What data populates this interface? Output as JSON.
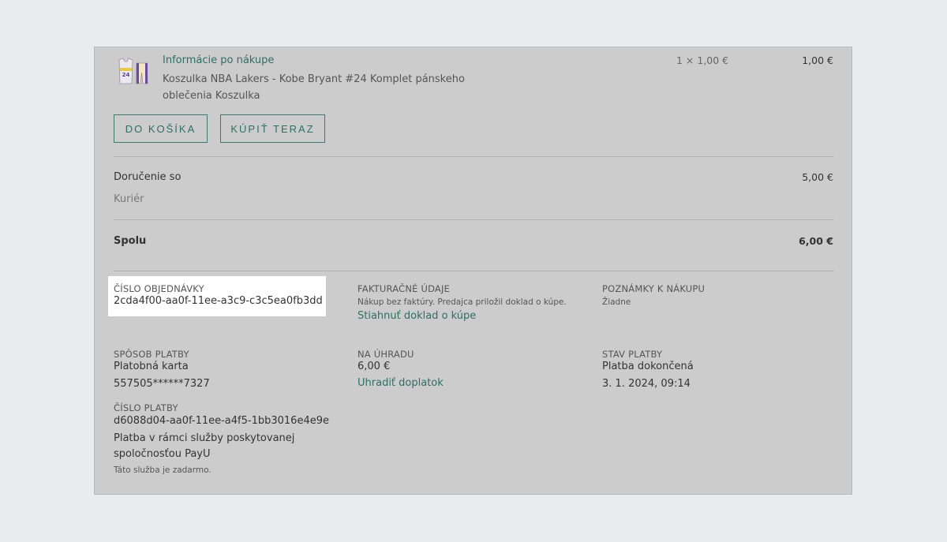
{
  "product": {
    "title": "Informácie po nákupe",
    "description": "Koszulka NBA Lakers - Kobe Bryant #24 Komplet pánskeho oblečenia Koszulka",
    "qty_price": "1 × 1,00 €",
    "line_price": "1,00 €",
    "image_icon": "jersey-icon",
    "jersey_number": "24"
  },
  "buttons": {
    "add_to_cart": "DO KOŠÍKA",
    "buy_now": "KÚPIŤ TERAZ"
  },
  "delivery": {
    "label": "Doručenie so",
    "method": "Kuriér",
    "price": "5,00 €"
  },
  "total": {
    "label": "Spolu",
    "price": "6,00 €"
  },
  "order": {
    "number_label": "ČÍSLO OBJEDNÁVKY",
    "number_value": "2cda4f00-aa0f-11ee-a3c9-c3c5ea0fb3dd"
  },
  "billing": {
    "label": "FAKTURAČNÉ ÚDAJE",
    "note": "Nákup bez faktúry. Predajca priložil doklad o kúpe.",
    "download_link": "Stiahnuť doklad o kúpe"
  },
  "notes": {
    "label": "POZNÁMKY K NÁKUPU",
    "value": "Žiadne"
  },
  "payment_method": {
    "label": "SPÔSOB PLATBY",
    "value": "Platobná karta",
    "card": "557505******7327"
  },
  "due": {
    "label": "NA ÚHRADU",
    "value": "6,00 €",
    "pay_link": "Uhradiť doplatok"
  },
  "payment_status": {
    "label": "STAV PLATBY",
    "value": "Platba dokončená",
    "date": "3. 1. 2024, 09:14"
  },
  "payment_number": {
    "label": "ČÍSLO PLATBY",
    "value": "d6088d04-aa0f-11ee-a4f5-1bb3016e4e9e",
    "provider_line1": "Platba v rámci služby poskytovanej",
    "provider_line2": "spoločnosťou PayU",
    "fee_note": "Táto služba je zadarmo."
  }
}
